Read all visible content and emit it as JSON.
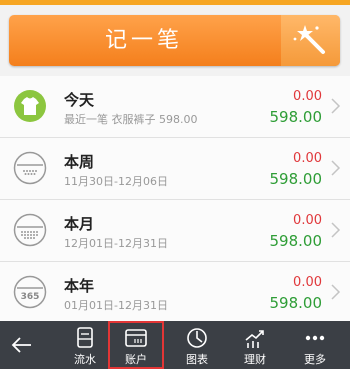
{
  "record_button": {
    "label": "记一笔"
  },
  "rows": [
    {
      "title": "今天",
      "sub": "最近一笔 衣服裤子 598.00",
      "expense": "0.00",
      "income": "598.00",
      "icon": "shirt-icon"
    },
    {
      "title": "本周",
      "sub": "11月30日-12月06日",
      "expense": "0.00",
      "income": "598.00",
      "icon": "week-icon"
    },
    {
      "title": "本月",
      "sub": "12月01日-12月31日",
      "expense": "0.00",
      "income": "598.00",
      "icon": "month-icon"
    },
    {
      "title": "本年",
      "sub": "01月01日-12月31日",
      "expense": "0.00",
      "income": "598.00",
      "icon": "year-icon",
      "badge": "365"
    }
  ],
  "tabbar": {
    "items": [
      {
        "label": "流水",
        "icon": "ledger-icon"
      },
      {
        "label": "账户",
        "icon": "wallet-icon"
      },
      {
        "label": "图表",
        "icon": "chart-icon"
      },
      {
        "label": "理财",
        "icon": "finance-icon"
      },
      {
        "label": "更多",
        "icon": "more-icon"
      }
    ]
  },
  "colors": {
    "accent_orange": "#f47f1c",
    "expense_red": "#e0383b",
    "income_green": "#2e9d36",
    "tabbar_bg": "#3b3f45",
    "selection_outline": "#e33636"
  }
}
